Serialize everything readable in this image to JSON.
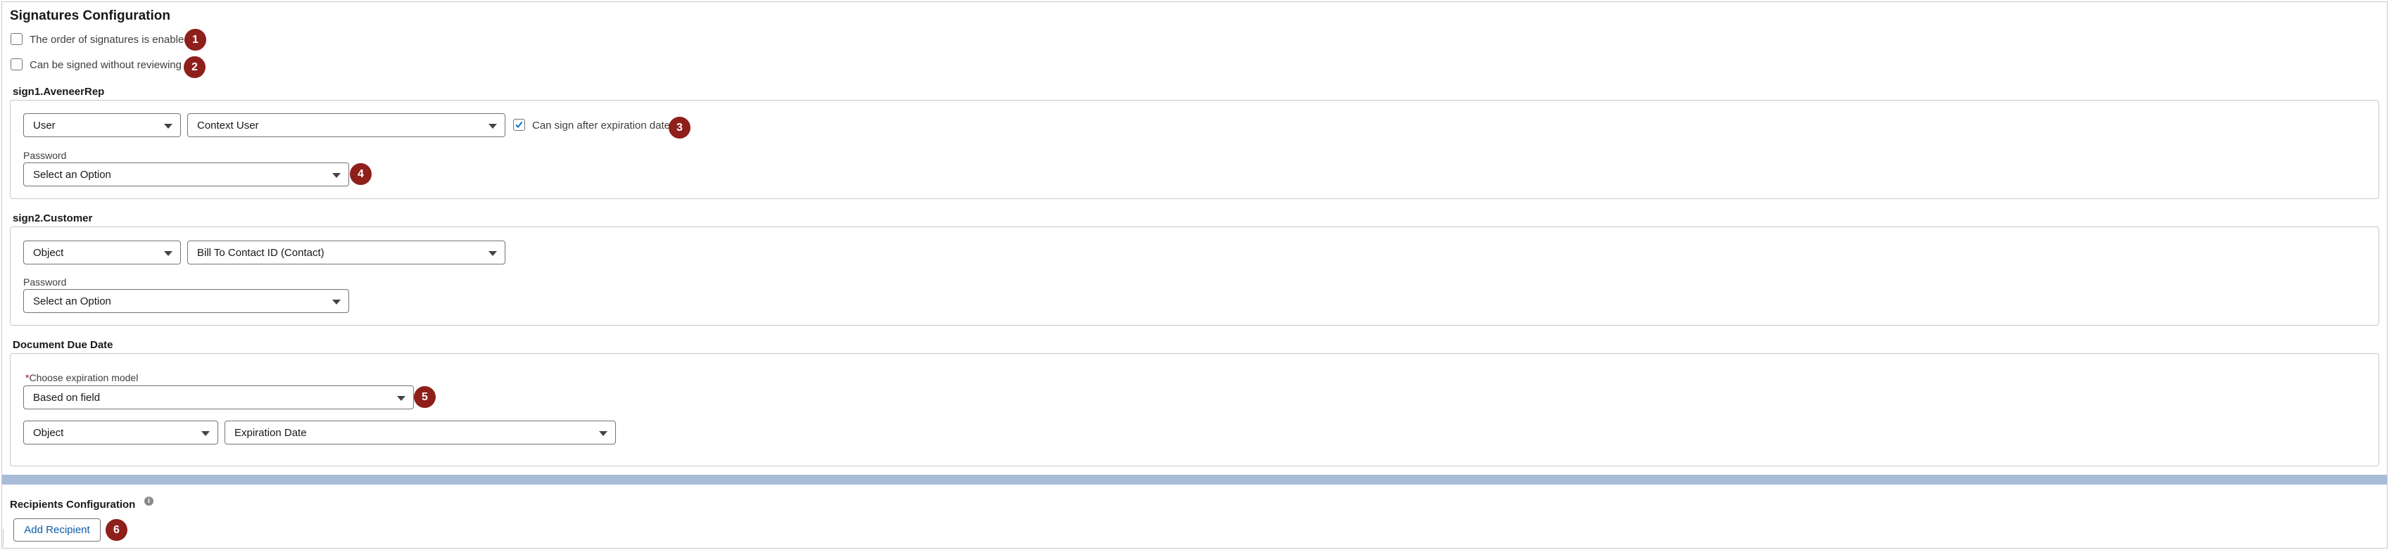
{
  "header": {
    "title": "Signatures Configuration"
  },
  "options": {
    "order_enabled": {
      "label": "The order of signatures is enabled",
      "badge": "1",
      "checked": false
    },
    "without_review": {
      "label": "Can be signed without reviewing",
      "badge": "2",
      "checked": false
    }
  },
  "sign1": {
    "title": "sign1.AveneerRep",
    "type_select": "User",
    "source_select": "Context User",
    "expiration_checkbox": {
      "label": "Can sign after expiration date",
      "badge": "3",
      "checked": true
    },
    "password_label": "Password",
    "password_select": "Select an Option",
    "password_badge": "4"
  },
  "sign2": {
    "title": "sign2.Customer",
    "type_select": "Object",
    "source_select": "Bill To Contact ID (Contact)",
    "password_label": "Password",
    "password_select": "Select an Option"
  },
  "due_date": {
    "title": "Document Due Date",
    "required_marker": "*",
    "model_label": "Choose expiration model",
    "model_select": "Based on field",
    "model_badge": "5",
    "object_select": "Object",
    "field_select": "Expiration Date"
  },
  "recipients": {
    "title": "Recipients Configuration",
    "info_icon": "i",
    "add_button": "Add Recipient",
    "add_badge": "6"
  },
  "icons": {
    "badge_color": "#8e1f1b",
    "accent_link": "#0b5cab",
    "divider": "#a8bcd8"
  }
}
